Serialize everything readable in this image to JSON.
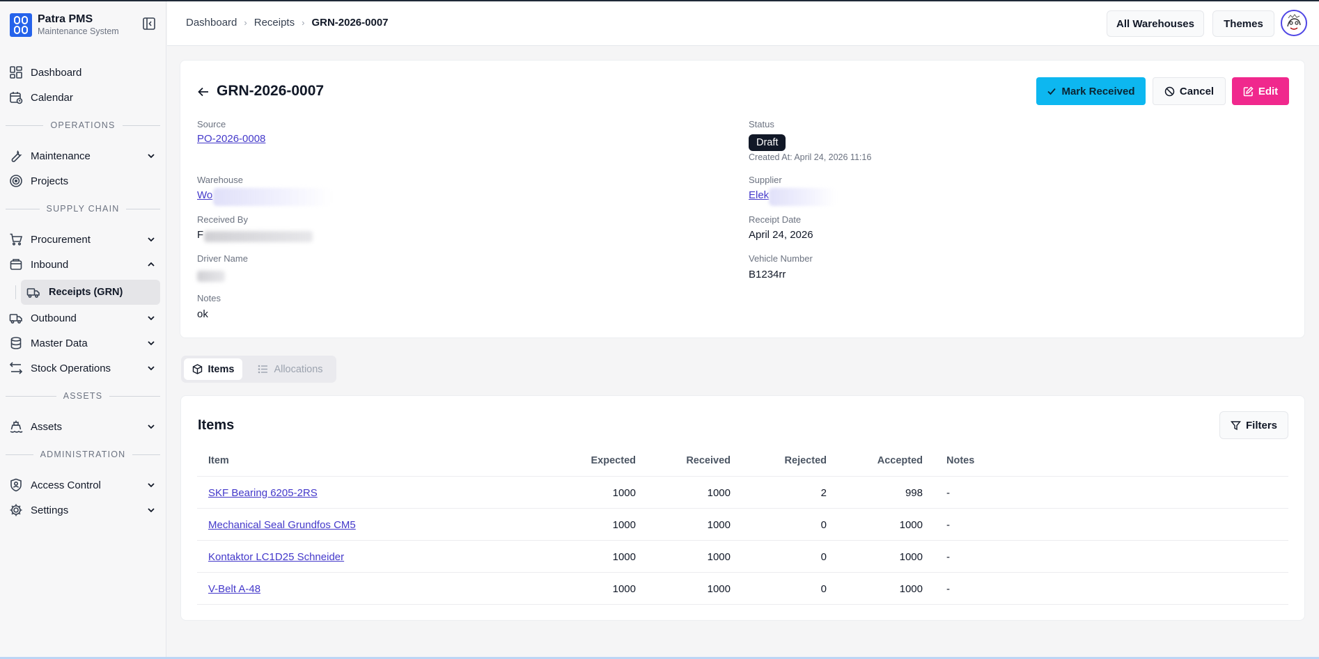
{
  "brand": {
    "title": "Patra PMS",
    "subtitle": "Maintenance System"
  },
  "sidebar": {
    "dashboard": "Dashboard",
    "calendar": "Calendar",
    "section_operations": "OPERATIONS",
    "maintenance": "Maintenance",
    "projects": "Projects",
    "section_supply_chain": "SUPPLY CHAIN",
    "procurement": "Procurement",
    "inbound": "Inbound",
    "receipts": "Receipts (GRN)",
    "outbound": "Outbound",
    "master_data": "Master Data",
    "stock_operations": "Stock Operations",
    "section_assets": "ASSETS",
    "assets": "Assets",
    "section_administration": "ADMINISTRATION",
    "access_control": "Access Control",
    "settings": "Settings"
  },
  "header": {
    "breadcrumb": [
      "Dashboard",
      "Receipts",
      "GRN-2026-0007"
    ],
    "warehouses_button": "All Warehouses",
    "themes_button": "Themes"
  },
  "detail": {
    "title": "GRN-2026-0007",
    "mark_received": "Mark Received",
    "cancel": "Cancel",
    "edit": "Edit",
    "source_label": "Source",
    "source_value": "PO-2026-0008",
    "status_label": "Status",
    "status_value": "Draft",
    "created_at": "Created At: April 24, 2026 11:16",
    "warehouse_label": "Warehouse",
    "warehouse_value": "Wo",
    "supplier_label": "Supplier",
    "supplier_value": "Elek",
    "received_by_label": "Received By",
    "received_by_value": "F",
    "receipt_date_label": "Receipt Date",
    "receipt_date_value": "April 24, 2026",
    "driver_label": "Driver Name",
    "vehicle_label": "Vehicle Number",
    "vehicle_value": "B1234rr",
    "notes_label": "Notes",
    "notes_value": "ok"
  },
  "tabs": {
    "items": "Items",
    "allocations": "Allocations"
  },
  "items_section": {
    "title": "Items",
    "filters": "Filters",
    "columns": [
      "Item",
      "Expected",
      "Received",
      "Rejected",
      "Accepted",
      "Notes"
    ],
    "rows": [
      {
        "item": "SKF Bearing 6205-2RS",
        "expected": "1000",
        "received": "1000",
        "rejected": "2",
        "accepted": "998",
        "notes": "-"
      },
      {
        "item": "Mechanical Seal Grundfos CM5",
        "expected": "1000",
        "received": "1000",
        "rejected": "0",
        "accepted": "1000",
        "notes": "-"
      },
      {
        "item": "Kontaktor LC1D25 Schneider",
        "expected": "1000",
        "received": "1000",
        "rejected": "0",
        "accepted": "1000",
        "notes": "-"
      },
      {
        "item": "V-Belt A-48",
        "expected": "1000",
        "received": "1000",
        "rejected": "0",
        "accepted": "1000",
        "notes": "-"
      }
    ]
  },
  "colors": {
    "accent_sky": "#0db7f0",
    "accent_pink": "#f0288d",
    "link": "#4338ca",
    "brand_blue": "#2563eb"
  }
}
